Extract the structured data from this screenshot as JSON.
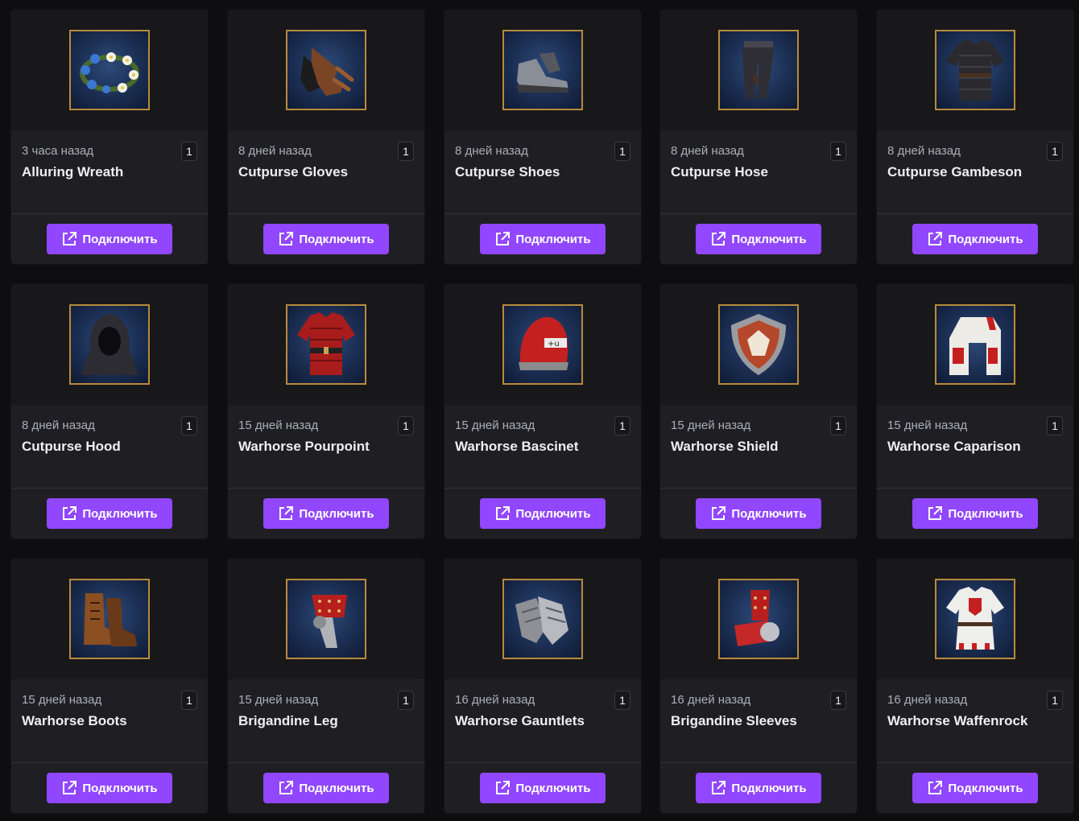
{
  "button_label": "Подключить",
  "accent_color": "#9147ff",
  "frame_color": "#b88a3b",
  "drops": [
    {
      "time": "3 часа назад",
      "name": "Alluring Wreath",
      "count": "1",
      "icon": "flower-wreath-icon"
    },
    {
      "time": "8 дней назад",
      "name": "Cutpurse Gloves",
      "count": "1",
      "icon": "leather-gloves-icon"
    },
    {
      "time": "8 дней назад",
      "name": "Cutpurse Shoes",
      "count": "1",
      "icon": "shoes-icon"
    },
    {
      "time": "8 дней назад",
      "name": "Cutpurse Hose",
      "count": "1",
      "icon": "hose-icon"
    },
    {
      "time": "8 дней назад",
      "name": "Cutpurse Gambeson",
      "count": "1",
      "icon": "gambeson-icon"
    },
    {
      "time": "8 дней назад",
      "name": "Cutpurse Hood",
      "count": "1",
      "icon": "hood-icon"
    },
    {
      "time": "15 дней назад",
      "name": "Warhorse Pourpoint",
      "count": "1",
      "icon": "pourpoint-icon"
    },
    {
      "time": "15 дней назад",
      "name": "Warhorse Bascinet",
      "count": "1",
      "icon": "bascinet-helmet-icon"
    },
    {
      "time": "15 дней назад",
      "name": "Warhorse Shield",
      "count": "1",
      "icon": "shield-icon"
    },
    {
      "time": "15 дней назад",
      "name": "Warhorse Caparison",
      "count": "1",
      "icon": "caparison-icon"
    },
    {
      "time": "15 дней назад",
      "name": "Warhorse Boots",
      "count": "1",
      "icon": "boots-icon"
    },
    {
      "time": "15 дней назад",
      "name": "Brigandine Leg",
      "count": "1",
      "icon": "leg-armor-icon"
    },
    {
      "time": "16 дней назад",
      "name": "Warhorse Gauntlets",
      "count": "1",
      "icon": "gauntlets-icon"
    },
    {
      "time": "16 дней назад",
      "name": "Brigandine Sleeves",
      "count": "1",
      "icon": "sleeves-armor-icon"
    },
    {
      "time": "16 дней назад",
      "name": "Warhorse Waffenrock",
      "count": "1",
      "icon": "waffenrock-icon"
    }
  ]
}
